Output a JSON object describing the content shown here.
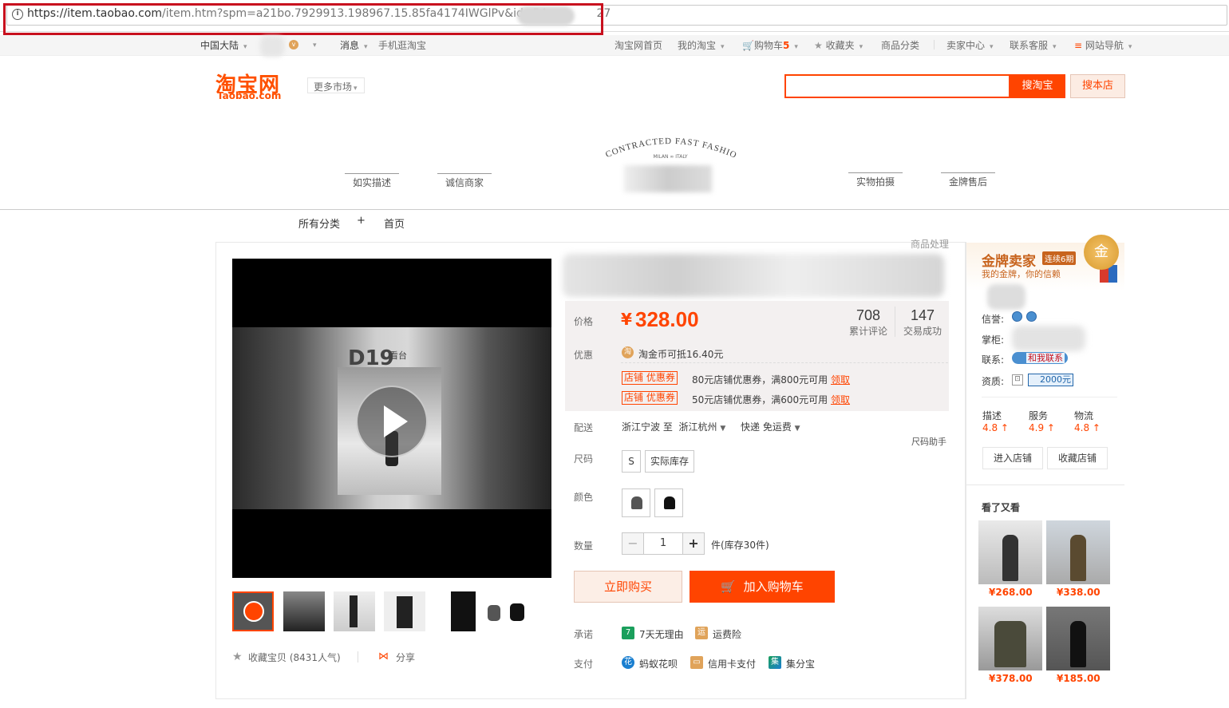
{
  "browser": {
    "url_host": "https://item.taobao.com",
    "url_path": "/item.htm?spm=a21bo.7929913.198967.15.85fa4174IWGlPv&id=54",
    "url_tail": "27"
  },
  "topnav": {
    "region": "中国大陆",
    "messages": "消息",
    "mobile": "手机逛淘宝",
    "home": "淘宝网首页",
    "mytaobao": "我的淘宝",
    "cart": "购物车",
    "cart_count": "5",
    "favorites": "收藏夹",
    "categories": "商品分类",
    "seller_center": "卖家中心",
    "service": "联系客服",
    "sitenav": "网站导航"
  },
  "header": {
    "logo_cn": "淘宝网",
    "logo_en": "Taobao.com",
    "more_markets": "更多市场",
    "search_placeholder": "",
    "search_taobao": "搜淘宝",
    "search_store": "搜本店"
  },
  "banner": {
    "shop_tagline": "CONTRACTED FAST FASHION",
    "shop_sub": "MILAN ∞ ITALY",
    "tags": [
      "如实描述",
      "诚信商家",
      "实物拍摄",
      "金牌售后"
    ]
  },
  "subnav": {
    "all_categories": "所有分类",
    "plus": "+",
    "home": "首页"
  },
  "product": {
    "goods_op": "商品处理",
    "video_text_big": "D19",
    "video_text_small": "看台",
    "price_label": "价格",
    "currency": "¥",
    "price": "328.00",
    "reviews_count": "708",
    "reviews_label": "累计评论",
    "sales_count": "147",
    "sales_label": "交易成功",
    "promo_label": "优惠",
    "coin_text": "淘金币可抵16.40元",
    "coupons": [
      {
        "tag": "店铺 优惠券",
        "text": "80元店铺优惠券，满800元可用",
        "action": "领取"
      },
      {
        "tag": "店铺 优惠券",
        "text": "50元店铺优惠券，满600元可用",
        "action": "领取"
      }
    ],
    "ship_label": "配送",
    "ship_from": "浙江宁波 至",
    "ship_to": "浙江杭州",
    "ship_fee": "快递 免运费",
    "size_help": "尺码助手",
    "size_label": "尺码",
    "sizes": [
      "S",
      "实际库存"
    ],
    "color_label": "颜色",
    "qty_label": "数量",
    "qty_value": "1",
    "qty_minus": "−",
    "qty_plus": "+",
    "stock_text": "件(库存30件)",
    "buy_now": "立即购买",
    "add_cart": "加入购物车",
    "promise_label": "承诺",
    "promise_items": [
      "7天无理由",
      "运费险"
    ],
    "pay_label": "支付",
    "pay_items": [
      "蚂蚁花呗",
      "信用卡支付",
      "集分宝"
    ],
    "collect_text": "收藏宝贝 (8431人气)",
    "share_text": "分享"
  },
  "seller": {
    "gold_title": "金牌卖家",
    "gold_badge": "连续6期",
    "gold_sub": "我的金牌，你的信赖",
    "medal_char": "金",
    "credit_label": "信誉:",
    "owner_label": "掌柜:",
    "contact_label": "联系:",
    "contact_btn": "和我联系",
    "qual_label": "资质:",
    "qual_amount": "2000元",
    "ratings": [
      {
        "name": "描述",
        "value": "4.8 ↑"
      },
      {
        "name": "服务",
        "value": "4.9 ↑"
      },
      {
        "name": "物流",
        "value": "4.8 ↑"
      }
    ],
    "enter_store": "进入店铺",
    "fav_store": "收藏店铺",
    "also_view": "看了又看",
    "recommendations": [
      {
        "price": "¥268.00"
      },
      {
        "price": "¥338.00"
      },
      {
        "price": "¥378.00"
      },
      {
        "price": "¥185.00"
      }
    ]
  },
  "colors": {
    "accent": "#ff4400",
    "highlight_box": "#c8101e"
  }
}
